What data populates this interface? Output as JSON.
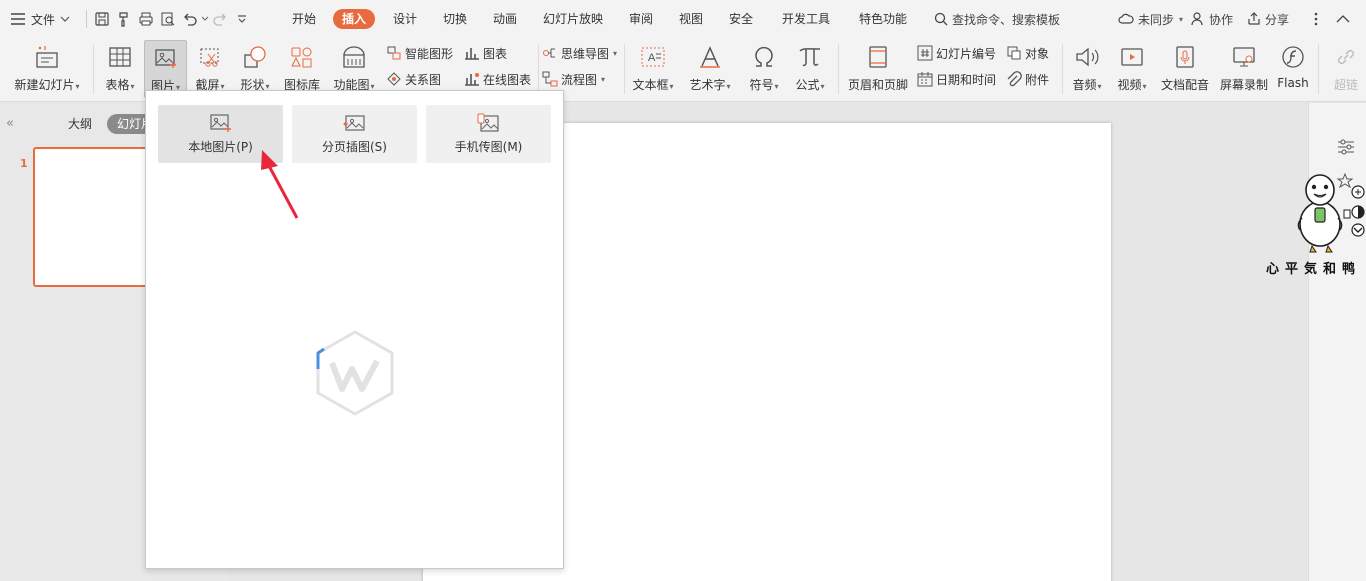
{
  "menubar": {
    "file_label": "文件",
    "tabs": [
      "开始",
      "插入",
      "设计",
      "切换",
      "动画",
      "幻灯片放映",
      "审阅",
      "视图",
      "安全",
      "开发工具",
      "特色功能"
    ],
    "active_tab": "插入",
    "search_placeholder": "查找命令、搜索模板",
    "sync_label": "未同步",
    "collab_label": "协作",
    "share_label": "分享"
  },
  "ribbon": {
    "new_slide": "新建幻灯片",
    "table": "表格",
    "picture": "图片",
    "screenshot": "截屏",
    "shape": "形状",
    "icon_lib": "图标库",
    "function_chart": "功能图",
    "smart_art": "智能图形",
    "chart": "图表",
    "relation": "关系图",
    "online_chart": "在线图表",
    "mind_map": "思维导图",
    "flowchart": "流程图",
    "textbox": "文本框",
    "wordart": "艺术字",
    "symbol": "符号",
    "formula": "公式",
    "header_footer": "页眉和页脚",
    "slide_number": "幻灯片编号",
    "object": "对象",
    "datetime": "日期和时间",
    "attachment": "附件",
    "audio": "音频",
    "video": "视频",
    "doc_dub": "文档配音",
    "screen_record": "屏幕录制",
    "flash": "Flash",
    "hyperlink": "超链"
  },
  "left_panel": {
    "tab_outline": "大纲",
    "tab_slides": "幻灯片",
    "slide_number": "1"
  },
  "picture_dropdown": {
    "options": [
      {
        "label": "本地图片(P)",
        "name": "local-picture"
      },
      {
        "label": "分页插图(S)",
        "name": "paged-insert"
      },
      {
        "label": "手机传图(M)",
        "name": "phone-transfer"
      }
    ]
  },
  "watermark": {
    "text": "心平気和鸭"
  },
  "colors": {
    "accent": "#e86a3f",
    "arrow": "#e8283a"
  }
}
